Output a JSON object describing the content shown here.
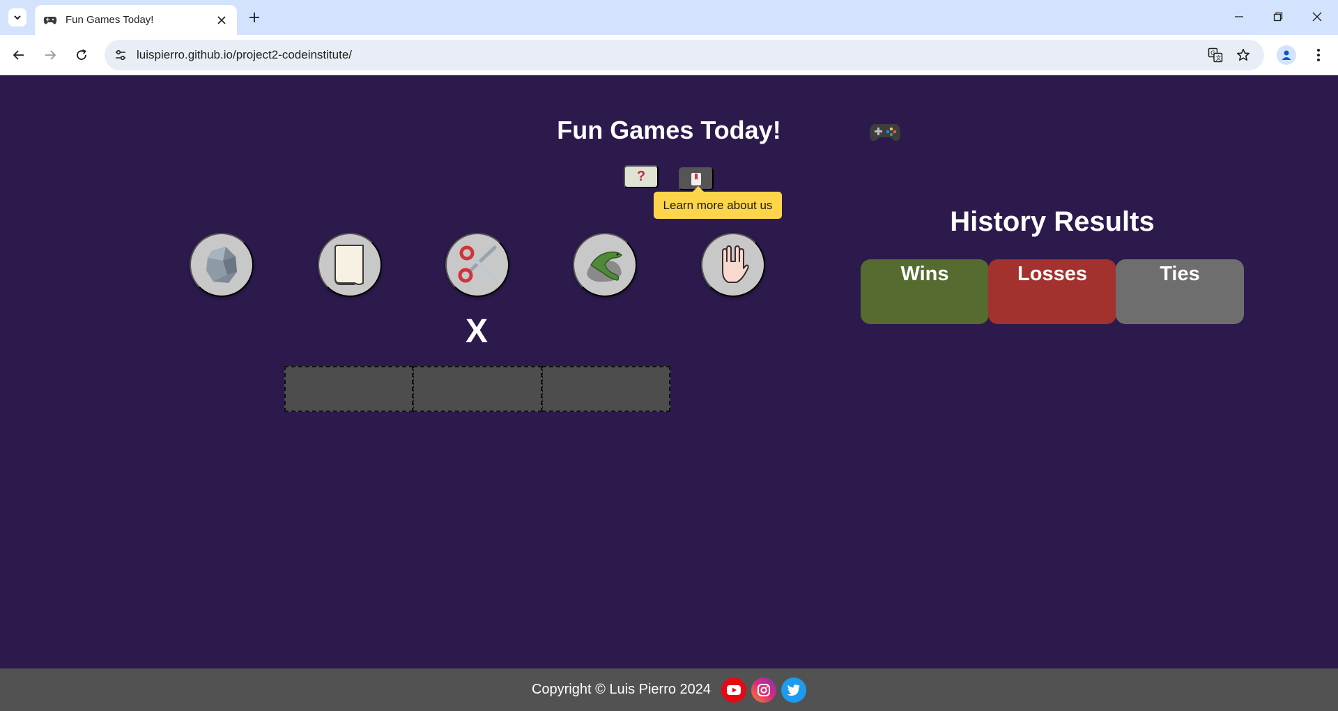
{
  "browser": {
    "tab_title": "Fun Games Today!",
    "url": "luispierro.github.io/project2-codeinstitute/"
  },
  "header": {
    "title": "Fun Games Today!",
    "controller_icon": "game-controller-icon",
    "help_label": "?",
    "about_tooltip": "Learn more about us"
  },
  "game": {
    "choices": [
      {
        "name": "rock",
        "icon": "rock-icon"
      },
      {
        "name": "paper",
        "icon": "paper-icon"
      },
      {
        "name": "scissors",
        "icon": "scissors-icon"
      },
      {
        "name": "lizard",
        "icon": "lizard-icon"
      },
      {
        "name": "spock",
        "icon": "spock-hand-icon"
      }
    ],
    "vs_label": "X"
  },
  "history": {
    "title": "History Results",
    "wins_label": "Wins",
    "losses_label": "Losses",
    "ties_label": "Ties",
    "colors": {
      "wins": "#556b2f",
      "losses": "#a3312e",
      "ties": "#6e6e6e"
    }
  },
  "footer": {
    "copyright": "Copyright © Luis Pierro 2024",
    "social": [
      "youtube-icon",
      "instagram-icon",
      "twitter-icon"
    ]
  },
  "theme": {
    "background": "#2c1a4d",
    "footer_bg": "#525252",
    "tooltip_bg": "#fdd54a"
  }
}
